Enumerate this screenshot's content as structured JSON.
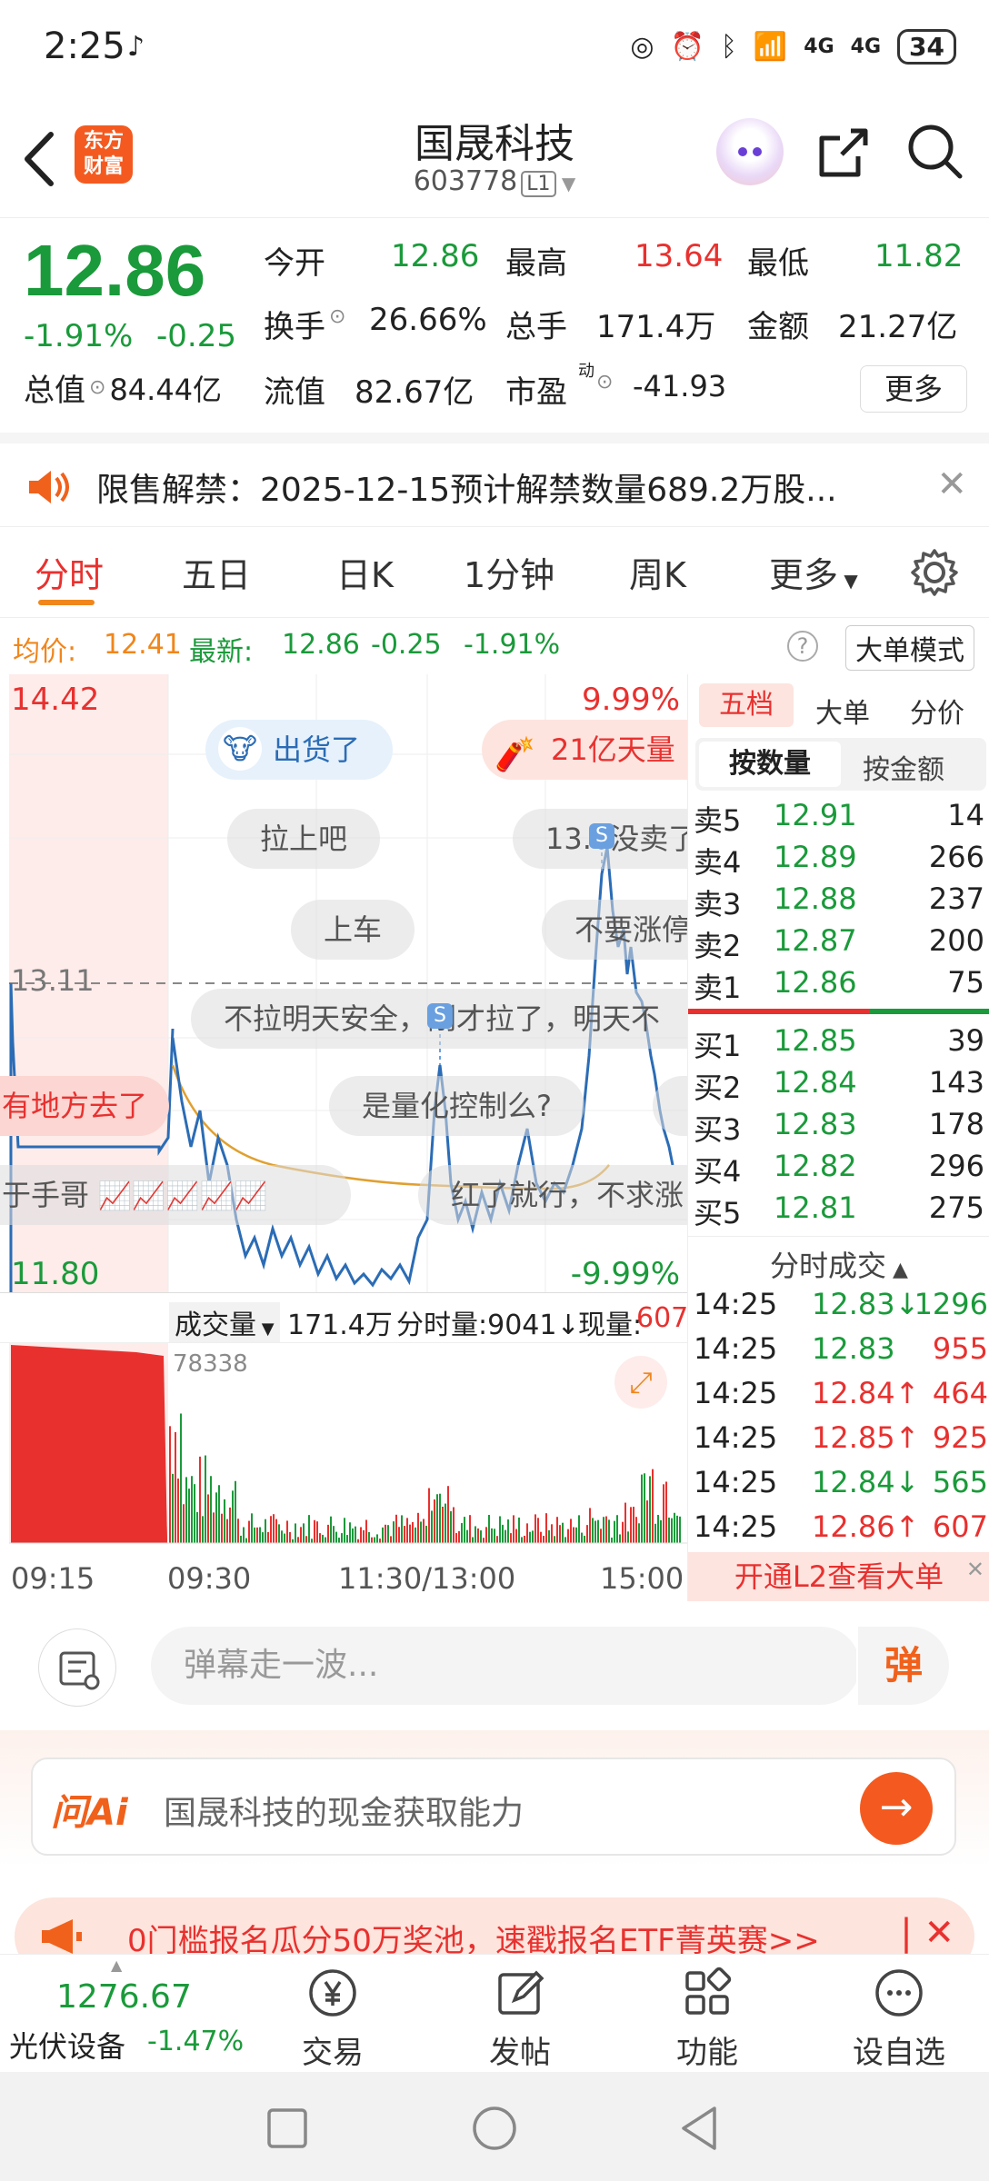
{
  "status": {
    "time": "2:25",
    "battery": "34",
    "net1": "4G",
    "net2": "4G"
  },
  "header": {
    "title": "国晟科技",
    "code": "603778",
    "level": "L1",
    "logo_line1": "东方",
    "logo_line2": "财富"
  },
  "quote": {
    "price": "12.86",
    "pct": "-1.91%",
    "chg": "-0.25",
    "open_label": "今开",
    "open": "12.86",
    "high_label": "最高",
    "high": "13.64",
    "low_label": "最低",
    "low": "11.82",
    "turnover_label": "换手",
    "turnover": "26.66%",
    "volume_label": "总手",
    "volume": "171.4万",
    "amount_label": "金额",
    "amount": "21.27亿",
    "mcap_label": "总值",
    "mcap": "84.44亿",
    "float_label": "流值",
    "float": "82.67亿",
    "pe_label": "市盈",
    "pe_sup": "动",
    "pe": "-41.93",
    "more": "更多"
  },
  "notice": {
    "text": "限售解禁：2025-12-15预计解禁数量689.2万股..."
  },
  "tabs": [
    "分时",
    "五日",
    "日K",
    "1分钟",
    "周K",
    "更多"
  ],
  "infoline": {
    "avg_label": "均价:",
    "avg": "12.41",
    "latest_label": "最新:",
    "latest": "12.86",
    "chg": "-0.25",
    "pct": "-1.91%",
    "mode_btn": "大单模式"
  },
  "chart": {
    "top_price": "14.42",
    "top_pct": "9.99%",
    "bottom_price": "11.80",
    "bottom_pct": "-9.99%",
    "ref_price": "13.11",
    "vol_label": "成交量",
    "vol_total": "171.4万",
    "vol_period": "分时量:9041↓",
    "vol_now_label": "现量:",
    "vol_now": "607",
    "vol_max": "78338",
    "times": [
      "09:15",
      "09:30",
      "11:30/13:00",
      "15:00"
    ],
    "bubbles": [
      "出货了",
      "21亿天量",
      "拉上吧",
      "13.6没卖了",
      "上车",
      "不要涨停",
      "不拉明天安全，刚才拉了，明天不",
      "是量化控制么?",
      "有地方去了",
      "于手哥",
      "红了就行，不求涨"
    ]
  },
  "book": {
    "tabs": [
      "五档",
      "大单",
      "分价"
    ],
    "subtabs": [
      "按数量",
      "按金额"
    ],
    "asks": [
      {
        "label": "卖5",
        "price": "12.91",
        "qty": "14"
      },
      {
        "label": "卖4",
        "price": "12.89",
        "qty": "266"
      },
      {
        "label": "卖3",
        "price": "12.88",
        "qty": "237"
      },
      {
        "label": "卖2",
        "price": "12.87",
        "qty": "200"
      },
      {
        "label": "卖1",
        "price": "12.86",
        "qty": "75"
      }
    ],
    "bids": [
      {
        "label": "买1",
        "price": "12.85",
        "qty": "39"
      },
      {
        "label": "买2",
        "price": "12.84",
        "qty": "143"
      },
      {
        "label": "买3",
        "price": "12.83",
        "qty": "178"
      },
      {
        "label": "买4",
        "price": "12.82",
        "qty": "296"
      },
      {
        "label": "买5",
        "price": "12.81",
        "qty": "275"
      }
    ],
    "trades_title": "分时成交",
    "trades": [
      {
        "time": "14:25",
        "price": "12.83↓",
        "qty": "1296"
      },
      {
        "time": "14:25",
        "price": "12.83",
        "qty": "955"
      },
      {
        "time": "14:25",
        "price": "12.84↑",
        "qty": "464"
      },
      {
        "time": "14:25",
        "price": "12.85↑",
        "qty": "925"
      },
      {
        "time": "14:25",
        "price": "12.84↓",
        "qty": "565"
      },
      {
        "time": "14:25",
        "price": "12.86↑",
        "qty": "607"
      }
    ],
    "l2_btn": "开通L2查看大单"
  },
  "danmu": {
    "placeholder": "弹幕走一波...",
    "btn": "弹"
  },
  "ai": {
    "logo": "问Ai",
    "prompt": "国晟科技的现金获取能力"
  },
  "promo": {
    "text": "0门槛报名瓜分50万奖池，速戳报名ETF菁英赛>>"
  },
  "bottom": {
    "index_value": "1276.67",
    "index_name": "光伏设备",
    "index_pct": "-1.47%",
    "nav": [
      "交易",
      "发帖",
      "功能",
      "设自选"
    ]
  },
  "colors": {
    "up": "#e8312f",
    "down": "#1a9a3a",
    "accent": "#f0861c",
    "price_line": "#2b6cb5",
    "avg_line": "#e0a030"
  }
}
